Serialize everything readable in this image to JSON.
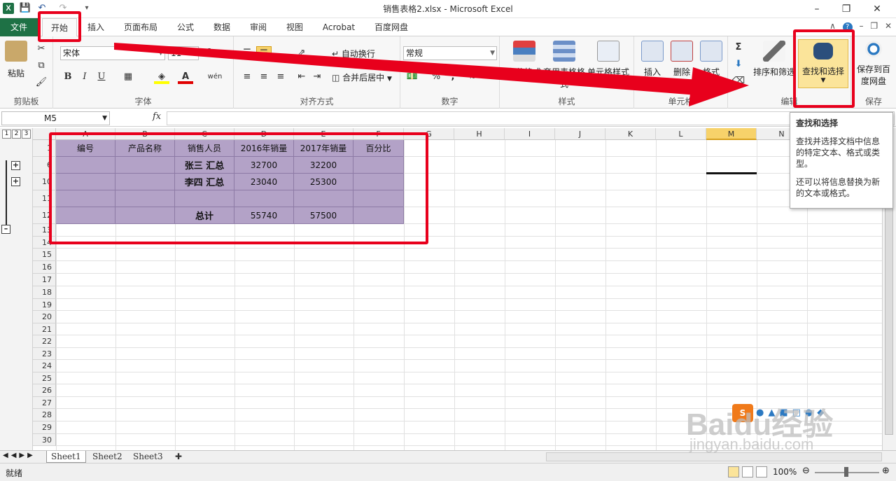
{
  "window": {
    "title": "销售表格2.xlsx  -  Microsoft Excel"
  },
  "tabs": {
    "file": "文件",
    "items": [
      "开始",
      "插入",
      "页面布局",
      "公式",
      "数据",
      "审阅",
      "视图",
      "Acrobat",
      "百度网盘"
    ],
    "active": "开始"
  },
  "ribbon": {
    "clipboard": {
      "label": "剪贴板",
      "paste": "粘贴"
    },
    "font": {
      "label": "字体",
      "name": "宋体",
      "size": "11",
      "bold": "B",
      "italic": "I",
      "underline": "U"
    },
    "alignment": {
      "label": "对齐方式",
      "wrap": "自动换行",
      "merge": "合并后居中"
    },
    "number": {
      "label": "数字",
      "format": "常规",
      "percent": "%",
      "comma": ","
    },
    "styles": {
      "label": "样式",
      "conditional": "条件格式",
      "table_format": "套用表格格式",
      "cell_styles": "单元格样式"
    },
    "cells": {
      "label": "单元格",
      "insert": "插入",
      "delete": "删除",
      "format": "格式"
    },
    "editing": {
      "label": "编辑",
      "sort": "排序和筛选",
      "find": "查找和选择"
    },
    "save": {
      "label": "保存",
      "save_baidu_1": "保存到百",
      "save_baidu_2": "度网盘"
    }
  },
  "formula_bar": {
    "name_box": "M5",
    "fx": "fx",
    "content": ""
  },
  "outline_levels": [
    "1",
    "2",
    "3"
  ],
  "columns": [
    "A",
    "B",
    "C",
    "D",
    "E",
    "F",
    "G",
    "H",
    "I",
    "J",
    "K",
    "L",
    "M",
    "N"
  ],
  "selected_column": "M",
  "rows": [
    "1",
    "6",
    "10",
    "11",
    "12",
    "13",
    "14",
    "15",
    "16",
    "17",
    "18",
    "19",
    "20",
    "21",
    "22",
    "23",
    "24",
    "25",
    "26",
    "27",
    "28",
    "29",
    "30"
  ],
  "table": {
    "headers": [
      "编号",
      "产品名称",
      "销售人员",
      "2016年销量",
      "2017年销量",
      "百分比"
    ],
    "rows": [
      [
        "",
        "",
        "张三  汇总",
        "32700",
        "32200",
        ""
      ],
      [
        "",
        "",
        "李四  汇总",
        "23040",
        "25300",
        ""
      ],
      [
        "",
        "",
        "",
        "",
        "",
        ""
      ],
      [
        "",
        "",
        "总计",
        "55740",
        "57500",
        ""
      ]
    ]
  },
  "tooltip": {
    "title": "查找和选择",
    "line1": "查找并选择文档中信息的特定文本、格式或类型。",
    "line2": "还可以将信息替换为新的文本或格式。"
  },
  "sheets": [
    "Sheet1",
    "Sheet2",
    "Sheet3"
  ],
  "active_sheet": "Sheet1",
  "status": {
    "ready": "就绪",
    "zoom": "100%"
  },
  "watermark": {
    "logo": "Baidu经验",
    "url": "jingyan.baidu.com"
  },
  "colors": {
    "accent": "#1e7145",
    "cell_fill": "#b3a2c7",
    "annotation": "#e8001c"
  }
}
